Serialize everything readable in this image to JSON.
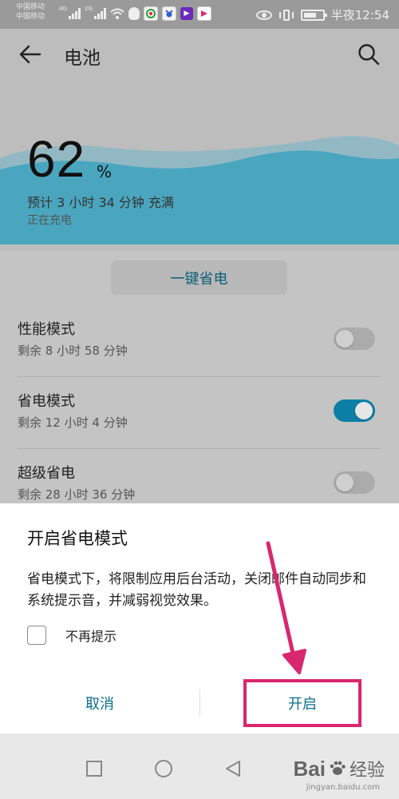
{
  "status_bar": {
    "carrier_1": "中国移动",
    "carrier_2": "中国移动",
    "net_1": "4G",
    "net_2": "2G",
    "time": "半夜12:54"
  },
  "header": {
    "title": "电池",
    "back_icon": "arrow-left-icon",
    "search_icon": "search-icon"
  },
  "battery": {
    "percent": "62",
    "percent_sign": "%",
    "estimate": "预计 3 小时 34 分钟 充满",
    "status": "正在充电",
    "wave_color": "#4aa6be"
  },
  "one_key_button": {
    "label": "一键省电"
  },
  "modes": [
    {
      "title": "性能模式",
      "remaining": "剩余 8 小时 58 分钟",
      "enabled": false
    },
    {
      "title": "省电模式",
      "remaining": "剩余 12 小时 4 分钟",
      "enabled": true
    },
    {
      "title": "超级省电",
      "remaining": "剩余 28 小时 36 分钟",
      "enabled": false
    }
  ],
  "dialog": {
    "title": "开启省电模式",
    "body": "省电模式下，将限制应用后台活动，关闭邮件自动同步和系统提示音，并减弱视觉效果。",
    "checkbox_label": "不再提示",
    "checkbox_checked": false,
    "cancel_label": "取消",
    "confirm_label": "开启"
  },
  "annotation": {
    "highlight_color": "#d9266f"
  },
  "nav_bar": {
    "recent_icon": "square-icon",
    "home_icon": "circle-icon",
    "back_icon": "triangle-back-icon"
  },
  "watermark": {
    "logo": "Bai",
    "text": "经验",
    "url": "jingyan.baidu.com"
  },
  "colors": {
    "accent": "#0b7fa6",
    "text_link": "#0a6e8f"
  }
}
